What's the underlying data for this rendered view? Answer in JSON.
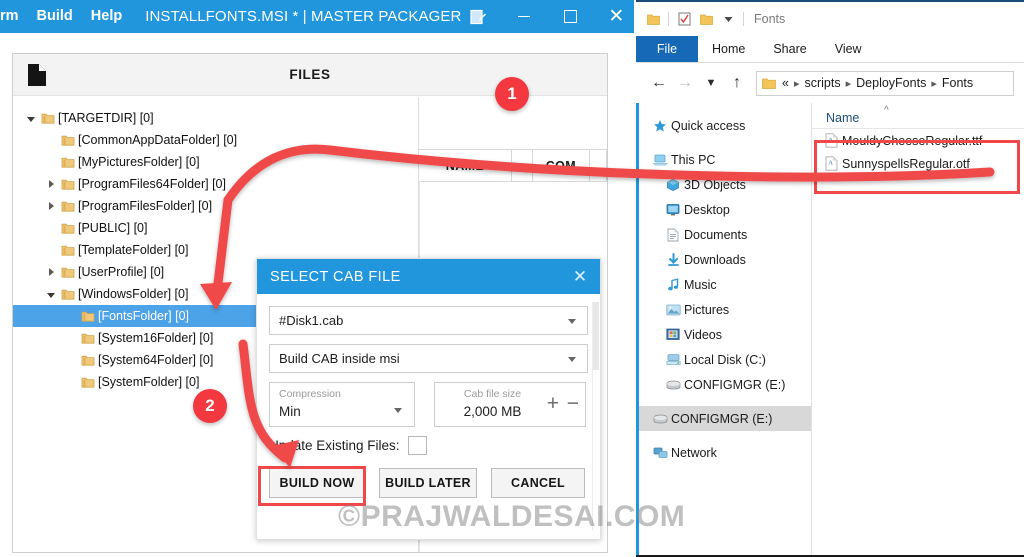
{
  "master_packager": {
    "menu": [
      {
        "label": "rm"
      },
      {
        "label": "Build"
      },
      {
        "label": "Help"
      }
    ],
    "document_title": "INSTALLFONTS.MSI * | MASTER PACKAGER",
    "edit_icon": "edit-document-icon",
    "window_controls": {
      "minimize": "minimize-icon",
      "maximize": "maximize-icon",
      "close": "close-icon"
    },
    "files_panel": {
      "title": "FILES",
      "icon": "document-icon",
      "columns": [
        "NAME",
        "COM"
      ],
      "tree": [
        {
          "label": "[TARGETDIR] [0]",
          "indent": 0,
          "twisty": "open",
          "selected": false
        },
        {
          "label": "[CommonAppDataFolder] [0]",
          "indent": 1,
          "twisty": "none",
          "selected": false
        },
        {
          "label": "[MyPicturesFolder] [0]",
          "indent": 1,
          "twisty": "none",
          "selected": false
        },
        {
          "label": "[ProgramFiles64Folder] [0]",
          "indent": 1,
          "twisty": "closed",
          "selected": false
        },
        {
          "label": "[ProgramFilesFolder] [0]",
          "indent": 1,
          "twisty": "closed",
          "selected": false
        },
        {
          "label": "[PUBLIC] [0]",
          "indent": 1,
          "twisty": "none",
          "selected": false
        },
        {
          "label": "[TemplateFolder] [0]",
          "indent": 1,
          "twisty": "none",
          "selected": false
        },
        {
          "label": "[UserProfile] [0]",
          "indent": 1,
          "twisty": "closed",
          "selected": false
        },
        {
          "label": "[WindowsFolder] [0]",
          "indent": 1,
          "twisty": "open",
          "selected": false
        },
        {
          "label": "[FontsFolder] [0]",
          "indent": 2,
          "twisty": "none",
          "selected": true
        },
        {
          "label": "[System16Folder] [0]",
          "indent": 2,
          "twisty": "none",
          "selected": false
        },
        {
          "label": "[System64Folder] [0]",
          "indent": 2,
          "twisty": "none",
          "selected": false
        },
        {
          "label": "[SystemFolder] [0]",
          "indent": 2,
          "twisty": "none",
          "selected": false
        }
      ]
    }
  },
  "cab_dialog": {
    "title": "SELECT CAB FILE",
    "close_icon": "close-icon",
    "cab_file": "#Disk1.cab",
    "build_mode": "Build CAB inside msi",
    "compression_label": "Compression",
    "compression_value": "Min",
    "cab_size_label": "Cab file size",
    "cab_size_value": "2,000 MB",
    "plus_icon": "plus-icon",
    "minus_icon": "minus-icon",
    "update_existing_label": "Update Existing Files:",
    "update_existing_checked": false,
    "buttons": {
      "build_now": "BUILD NOW",
      "build_later": "BUILD LATER",
      "cancel": "CANCEL"
    }
  },
  "file_explorer": {
    "quick_access_toolbar": {
      "folder_icon": "folder-icon",
      "properties_icon": "properties-checkbox-icon",
      "new_folder_icon": "new-folder-icon",
      "customize_icon": "chevron-down-icon",
      "title": "Fonts"
    },
    "ribbon_tabs": [
      {
        "label": "File",
        "active": true
      },
      {
        "label": "Home",
        "active": false
      },
      {
        "label": "Share",
        "active": false
      },
      {
        "label": "View",
        "active": false
      }
    ],
    "navigation": {
      "back_icon": "arrow-left-icon",
      "forward_icon": "arrow-right-icon",
      "recent_icon": "chevron-down-icon",
      "up_icon": "arrow-up-icon"
    },
    "breadcrumb": {
      "folder_icon": "folder-icon",
      "overflow": "«",
      "parts": [
        "scripts",
        "DeployFonts",
        "Fonts"
      ]
    },
    "nav_pane": [
      {
        "label": "Quick access",
        "icon": "star-icon",
        "level": 0,
        "selected": false,
        "gap_before": false
      },
      {
        "label": "This PC",
        "icon": "pc-icon",
        "level": 0,
        "selected": false,
        "gap_before": true
      },
      {
        "label": "3D Objects",
        "icon": "3d-objects-icon",
        "level": 1,
        "selected": false,
        "gap_before": false
      },
      {
        "label": "Desktop",
        "icon": "desktop-icon",
        "level": 1,
        "selected": false,
        "gap_before": false
      },
      {
        "label": "Documents",
        "icon": "documents-icon",
        "level": 1,
        "selected": false,
        "gap_before": false
      },
      {
        "label": "Downloads",
        "icon": "downloads-icon",
        "level": 1,
        "selected": false,
        "gap_before": false
      },
      {
        "label": "Music",
        "icon": "music-icon",
        "level": 1,
        "selected": false,
        "gap_before": false
      },
      {
        "label": "Pictures",
        "icon": "pictures-icon",
        "level": 1,
        "selected": false,
        "gap_before": false
      },
      {
        "label": "Videos",
        "icon": "videos-icon",
        "level": 1,
        "selected": false,
        "gap_before": false
      },
      {
        "label": "Local Disk (C:)",
        "icon": "harddisk-icon",
        "level": 1,
        "selected": false,
        "gap_before": false
      },
      {
        "label": "CONFIGMGR (E:)",
        "icon": "drive-icon",
        "level": 1,
        "selected": false,
        "gap_before": false
      },
      {
        "label": "CONFIGMGR (E:)",
        "icon": "drive-icon",
        "level": 0,
        "selected": true,
        "gap_before": true
      },
      {
        "label": "Network",
        "icon": "network-icon",
        "level": 0,
        "selected": false,
        "gap_before": true
      }
    ],
    "list_header": {
      "name": "Name",
      "sort_caret": "chevron-up-icon"
    },
    "files": [
      {
        "name": "MouldyCheeseRegular.ttf",
        "icon": "font-file-icon"
      },
      {
        "name": "SunnyspellsRegular.otf",
        "icon": "font-file-icon"
      }
    ]
  },
  "annotations": {
    "badges": [
      {
        "number": "1"
      },
      {
        "number": "2"
      }
    ],
    "accent_red": "#f3383f",
    "accent_blue": "#2196dd",
    "highlight_box_color": "#f0484a"
  },
  "watermark": "©PRAJWALDESAI.COM"
}
